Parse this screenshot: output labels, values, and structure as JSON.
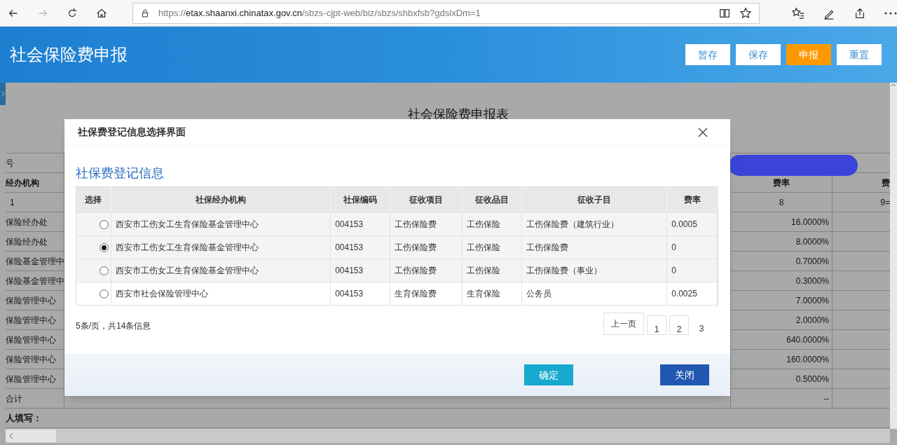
{
  "browser": {
    "url": {
      "scheme": "https://",
      "host": "etax.shaanxi.chinatax.gov.cn",
      "path": "/sbzs-cjpt-web/biz/sbzs/shbxfsb?gdslxDm=1"
    }
  },
  "header": {
    "title": "社会保险费申报",
    "buttons": [
      {
        "label": "暂存",
        "kind": "default"
      },
      {
        "label": "保存",
        "kind": "default"
      },
      {
        "label": "申报",
        "kind": "primary"
      },
      {
        "label": "重置",
        "kind": "default"
      }
    ]
  },
  "page": {
    "title": "社会保险费申报表",
    "caption": "号",
    "header": {
      "label": "经办机构",
      "rate": "费率",
      "next": "费"
    },
    "rows": [
      {
        "label": "1",
        "rate": "8",
        "next": "9="
      },
      {
        "label": "保险经办处",
        "rate": "16.0000%"
      },
      {
        "label": "保险经办处",
        "rate": "8.0000%"
      },
      {
        "label": "保险基金管理中",
        "rate": "0.7000%"
      },
      {
        "label": "保险基金管理中",
        "rate": "0.3000%"
      },
      {
        "label": "保险管理中心",
        "rate": "7.0000%"
      },
      {
        "label": "保险管理中心",
        "rate": "2.0000%"
      },
      {
        "label": "保险管理中心",
        "rate": "640.0000%"
      },
      {
        "label": "保险管理中心",
        "rate": "160.0000%"
      },
      {
        "label": "保险管理中心",
        "rate": "0.5000%"
      },
      {
        "label": "合计",
        "rate": "--"
      }
    ],
    "footer_label": "人填写："
  },
  "dialog": {
    "title": "社保费登记信息选择界面",
    "subtitle": "社保费登记信息",
    "columns": [
      "选择",
      "社保经办机构",
      "社保编码",
      "征收项目",
      "征收品目",
      "征收子目",
      "费率"
    ],
    "rows": [
      {
        "selected": false,
        "agency": "西安市工伤女工生育保险基金管理中心",
        "code": "004153",
        "item": "工伤保险费",
        "category": "工伤保险",
        "subitem": "工伤保险费（建筑行业）",
        "rate": "0.0005"
      },
      {
        "selected": true,
        "agency": "西安市工伤女工生育保险基金管理中心",
        "code": "004153",
        "item": "工伤保险费",
        "category": "工伤保险",
        "subitem": "工伤保险费",
        "rate": "0"
      },
      {
        "selected": false,
        "agency": "西安市工伤女工生育保险基金管理中心",
        "code": "004153",
        "item": "工伤保险费",
        "category": "工伤保险",
        "subitem": "工伤保险费（事业）",
        "rate": "0"
      },
      {
        "selected": false,
        "agency": "西安市社会保险管理中心",
        "code": "004153",
        "item": "生育保险费",
        "category": "生育保险",
        "subitem": "公务员",
        "rate": "0.0025"
      }
    ],
    "summary": "5条/页，共14条信息",
    "prev_label": "上一页",
    "pages": [
      {
        "label": "1",
        "selected": false
      },
      {
        "label": "2",
        "selected": false
      },
      {
        "label": "3",
        "selected": true
      }
    ],
    "buttons": [
      {
        "label": "确定",
        "kind": "confirm"
      },
      {
        "label": "关闭",
        "kind": "close"
      }
    ]
  }
}
